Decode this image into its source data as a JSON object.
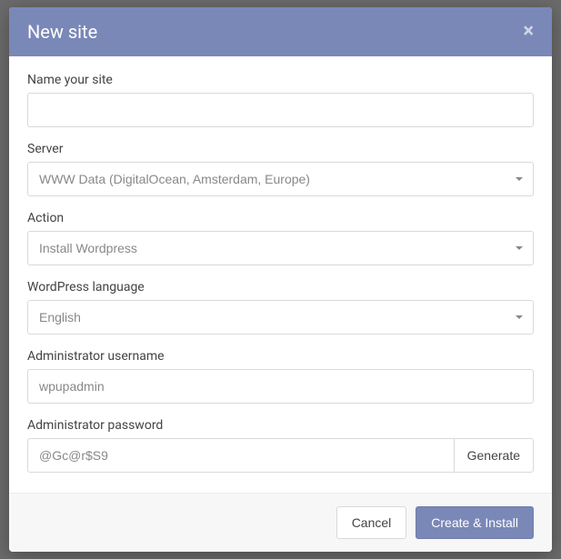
{
  "modal": {
    "title": "New site"
  },
  "form": {
    "name": {
      "label": "Name your site",
      "value": ""
    },
    "server": {
      "label": "Server",
      "value": "WWW Data (DigitalOcean, Amsterdam, Europe)"
    },
    "action": {
      "label": "Action",
      "value": "Install Wordpress"
    },
    "language": {
      "label": "WordPress language",
      "value": "English"
    },
    "admin_user": {
      "label": "Administrator username",
      "value": "wpupadmin"
    },
    "admin_pass": {
      "label": "Administrator password",
      "value": "@Gc@r$S9",
      "generate_label": "Generate"
    }
  },
  "footer": {
    "cancel": "Cancel",
    "submit": "Create & Install"
  }
}
